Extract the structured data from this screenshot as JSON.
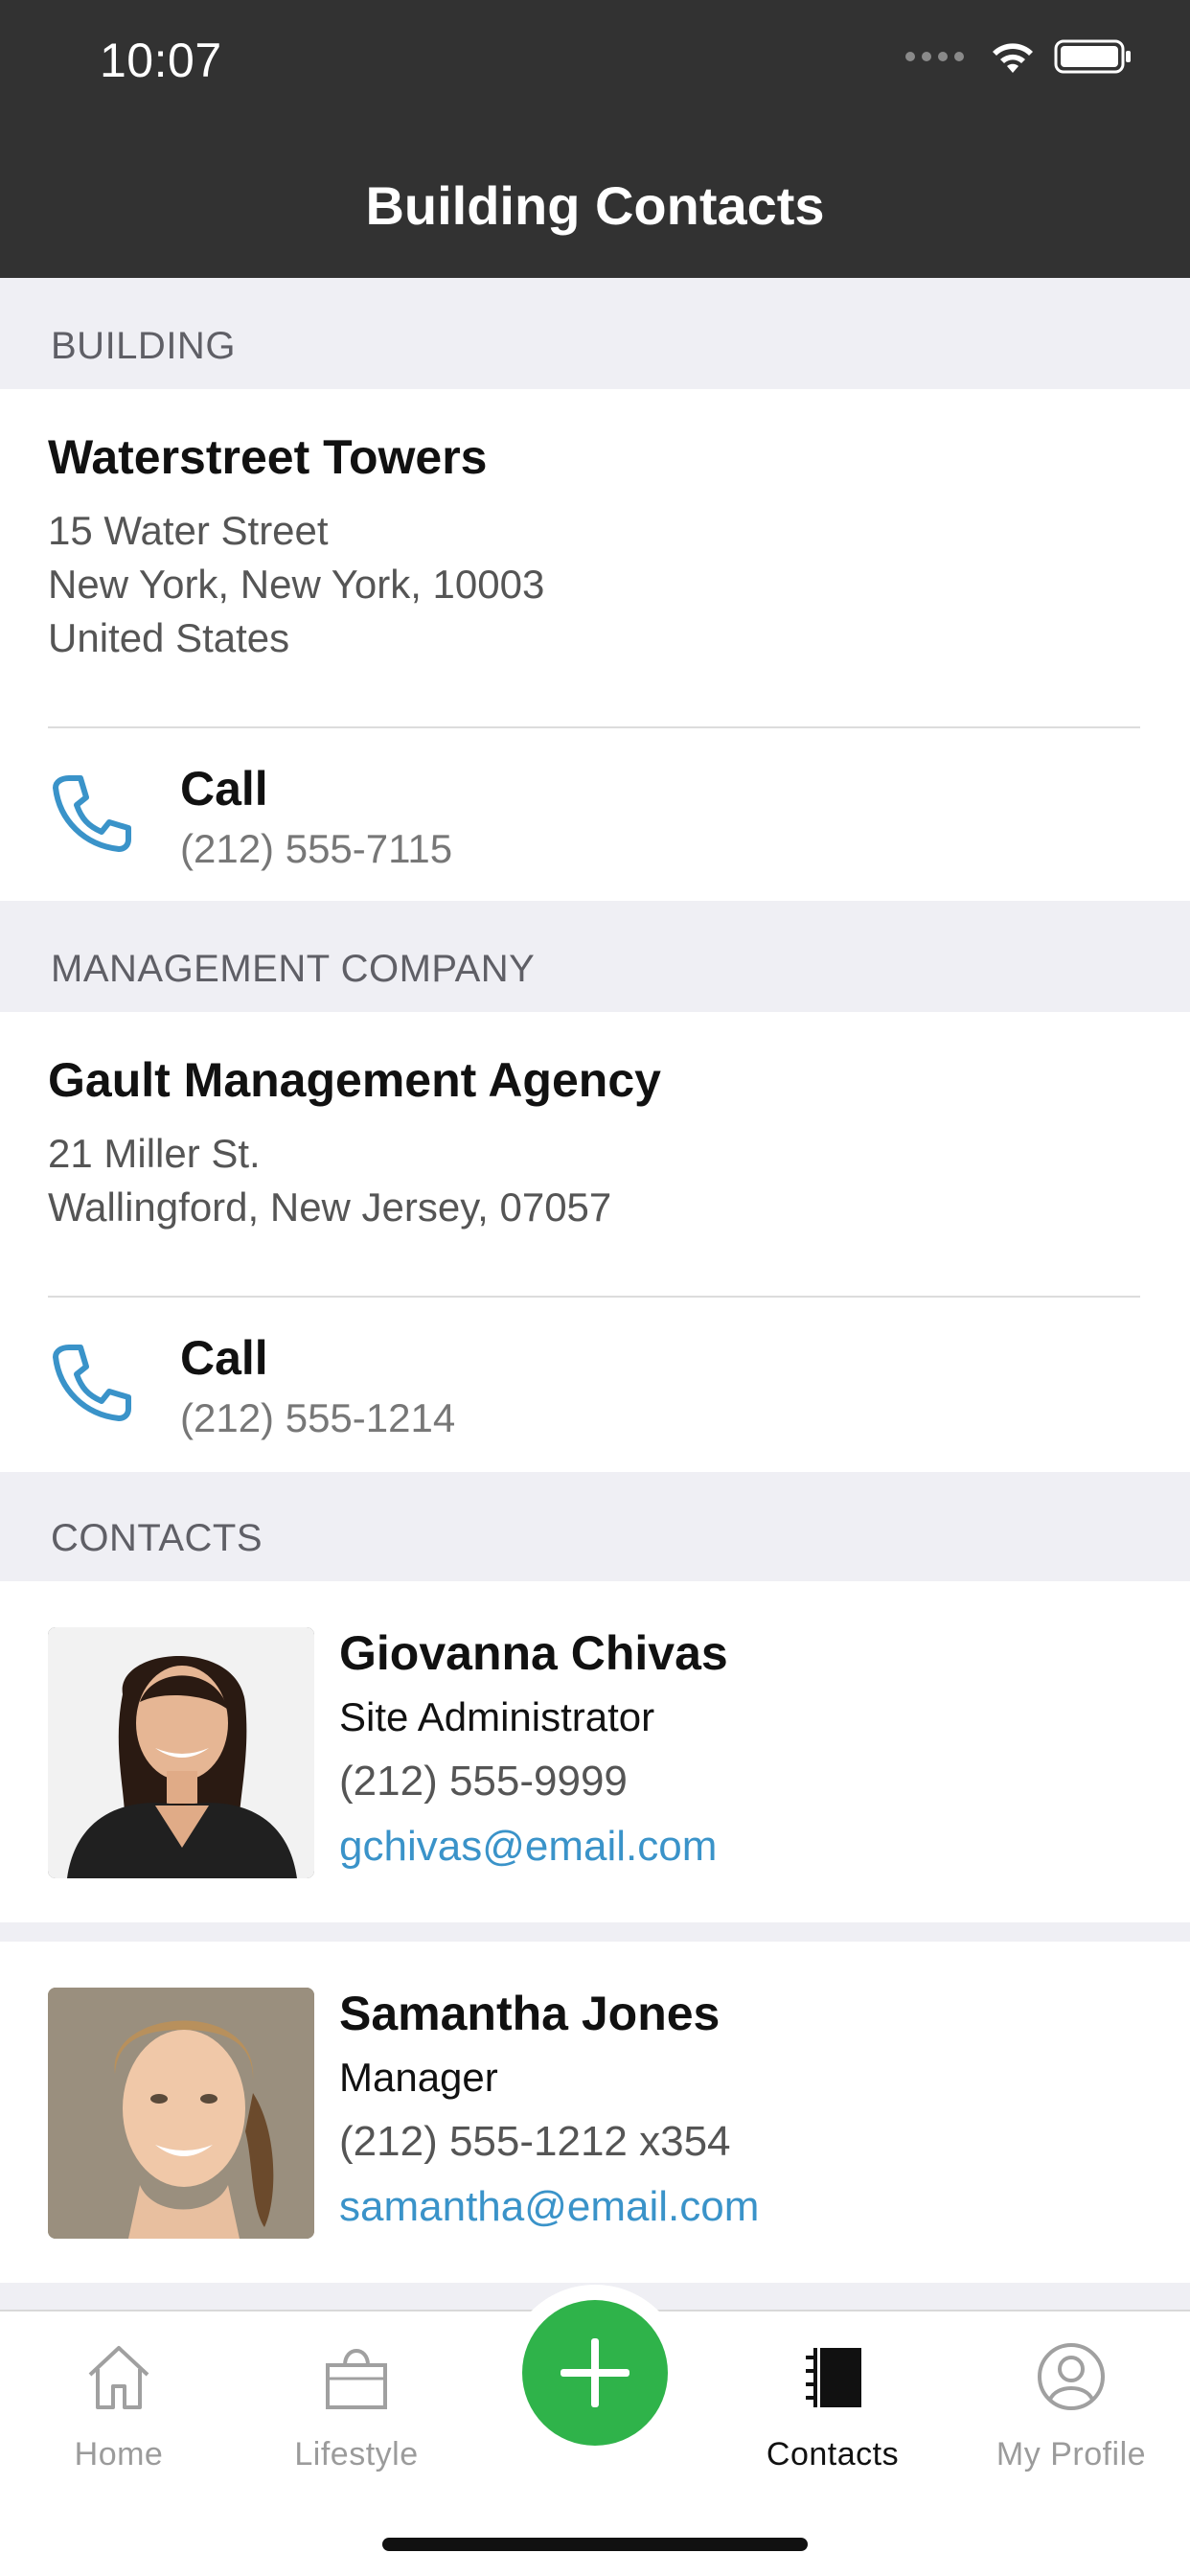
{
  "status": {
    "time": "10:07"
  },
  "nav": {
    "title": "Building Contacts"
  },
  "sections": {
    "building": "BUILDING",
    "management": "MANAGEMENT COMPANY",
    "contacts": "CONTACTS"
  },
  "building": {
    "name": "Waterstreet Towers",
    "address_line1": "15 Water Street",
    "address_line2": "New York, New York, 10003",
    "address_line3": "United States",
    "call_label": "Call",
    "phone": "(212) 555-7115"
  },
  "management": {
    "name": "Gault Management Agency",
    "address_line1": "21 Miller St.",
    "address_line2": "Wallingford, New Jersey, 07057",
    "call_label": "Call",
    "phone": "(212) 555-1214"
  },
  "contacts": [
    {
      "name": "Giovanna Chivas",
      "role": "Site Administrator",
      "phone": "(212) 555-9999",
      "email": "gchivas@email.com"
    },
    {
      "name": "Samantha Jones",
      "role": "Manager",
      "phone": "(212) 555-1212 x354",
      "email": "samantha@email.com"
    }
  ],
  "tabs": [
    {
      "label": "Home",
      "icon": "home-icon",
      "active": false
    },
    {
      "label": "Lifestyle",
      "icon": "shopping-bag-icon",
      "active": false
    },
    {
      "label": "Contacts",
      "icon": "address-book-icon",
      "active": true
    },
    {
      "label": "My Profile",
      "icon": "profile-icon",
      "active": false
    }
  ],
  "colors": {
    "accent": "#3a93c9",
    "add_button": "#2fb34a",
    "nav_bg": "#323232"
  }
}
